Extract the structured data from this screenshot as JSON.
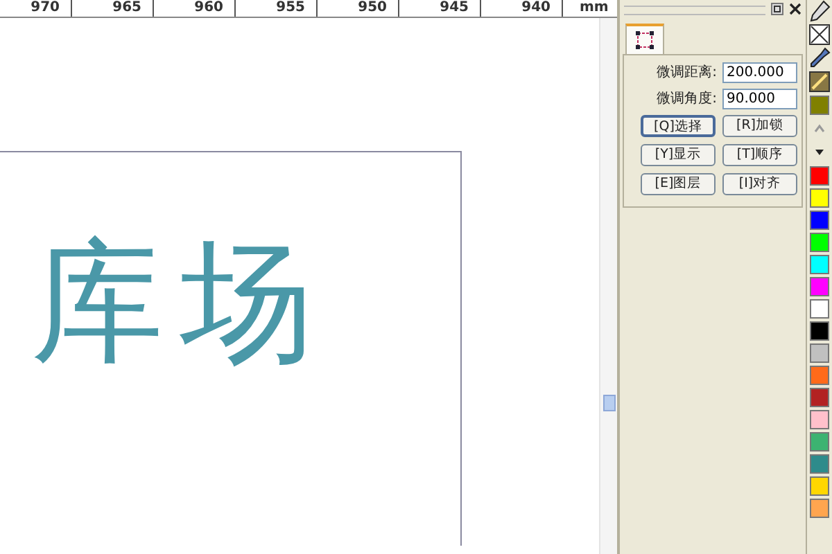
{
  "ruler": {
    "labels": [
      "970",
      "965",
      "960",
      "955",
      "950",
      "945",
      "940"
    ],
    "unit": "mm"
  },
  "canvas": {
    "text": "库场"
  },
  "docker": {
    "tabs": [
      {
        "selected": true
      }
    ],
    "fields": [
      {
        "label": "微调距离:",
        "value": "200.000"
      },
      {
        "label": "微调角度:",
        "value": "90.000"
      }
    ],
    "buttons": [
      {
        "label": "[Q]选择",
        "focused": true
      },
      {
        "label": "[R]加锁",
        "focused": false
      },
      {
        "label": "[Y]显示",
        "focused": false
      },
      {
        "label": "[T]顺序",
        "focused": false
      },
      {
        "label": "[E]图层",
        "focused": false
      },
      {
        "label": "[I]对齐",
        "focused": false
      }
    ]
  },
  "palette": {
    "swatches": [
      {
        "color": "#808000"
      },
      {
        "color": "#ff0000"
      },
      {
        "color": "#ffff00"
      },
      {
        "color": "#0000ff"
      },
      {
        "color": "#00ff00"
      },
      {
        "color": "#00ffff"
      },
      {
        "color": "#ff00ff"
      },
      {
        "color": "#ffffff"
      },
      {
        "color": "#000000"
      },
      {
        "color": "#c0c0c0"
      },
      {
        "color": "#ff6a1a"
      },
      {
        "color": "#b22222"
      },
      {
        "color": "#ffc0cb"
      },
      {
        "color": "#3cb371"
      },
      {
        "color": "#2e8b8b"
      },
      {
        "color": "#ffd700"
      },
      {
        "color": "#ffa54f"
      }
    ]
  }
}
